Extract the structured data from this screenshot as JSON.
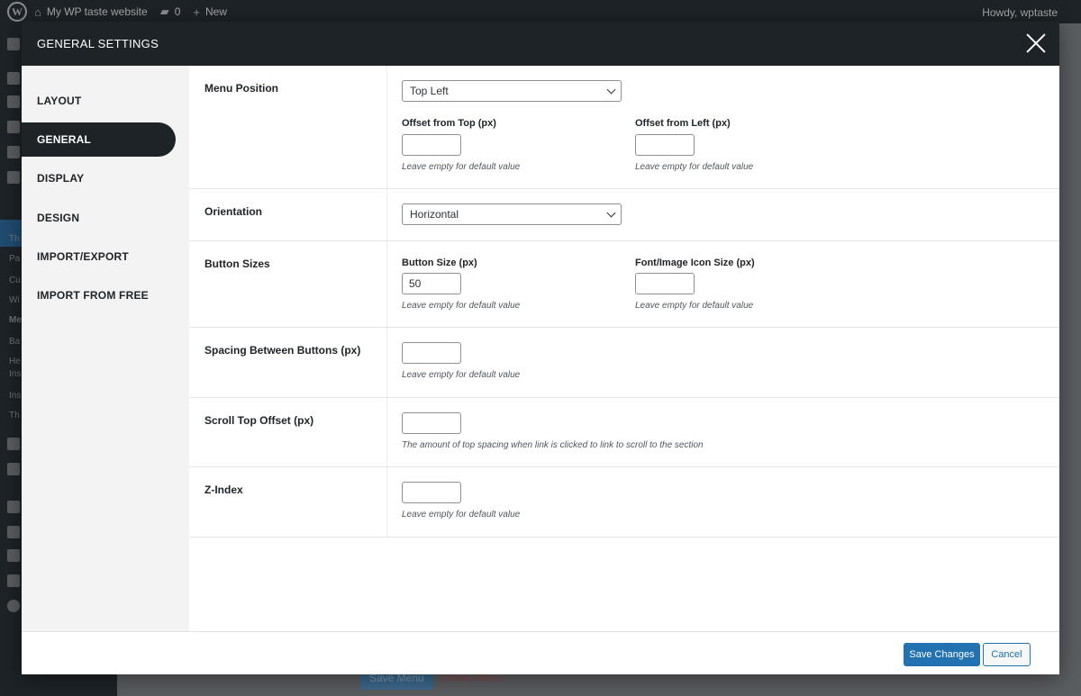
{
  "adminbar": {
    "site_name": "My WP taste website",
    "comments_count": "0",
    "new_label": "New",
    "howdy": "Howdy, wptaste"
  },
  "background": {
    "sidebar_fragments": [
      "Th",
      "Pa",
      "Cu",
      "Wi",
      "Me",
      "Ba",
      "He",
      "Ins",
      "Ins",
      "Th"
    ],
    "save_menu_label": "Save Menu",
    "delete_menu_label": "Delete Menu"
  },
  "modal": {
    "title": "GENERAL SETTINGS",
    "nav": [
      {
        "label": "LAYOUT",
        "active": false
      },
      {
        "label": "GENERAL",
        "active": true
      },
      {
        "label": "DISPLAY",
        "active": false
      },
      {
        "label": "DESIGN",
        "active": false
      },
      {
        "label": "IMPORT/EXPORT",
        "active": false
      },
      {
        "label": "IMPORT FROM FREE",
        "active": false
      }
    ],
    "rows": {
      "menu_position": {
        "label": "Menu Position",
        "select_value": "Top Left",
        "offset_top_label": "Offset from Top (px)",
        "offset_top_value": "",
        "offset_top_hint": "Leave empty for default value",
        "offset_left_label": "Offset from Left (px)",
        "offset_left_value": "",
        "offset_left_hint": "Leave empty for default value"
      },
      "orientation": {
        "label": "Orientation",
        "select_value": "Horizontal"
      },
      "button_sizes": {
        "label": "Button Sizes",
        "button_size_label": "Button Size (px)",
        "button_size_value": "50",
        "button_size_hint": "Leave empty for default value",
        "icon_size_label": "Font/Image Icon Size (px)",
        "icon_size_value": "",
        "icon_size_hint": "Leave empty for default value"
      },
      "spacing": {
        "label": "Spacing Between Buttons (px)",
        "value": "",
        "hint": "Leave empty for default value"
      },
      "scroll_offset": {
        "label": "Scroll Top Offset (px)",
        "value": "",
        "hint": "The amount of top spacing when link is clicked to link to scroll to the section"
      },
      "z_index": {
        "label": "Z-Index",
        "value": "",
        "hint": "Leave empty for default value"
      }
    },
    "footer": {
      "save_label": "Save Changes",
      "cancel_label": "Cancel"
    }
  },
  "colors": {
    "header_dark": "#1d2327",
    "primary": "#2271b1",
    "sidebar_bg": "#f3f3f3"
  }
}
